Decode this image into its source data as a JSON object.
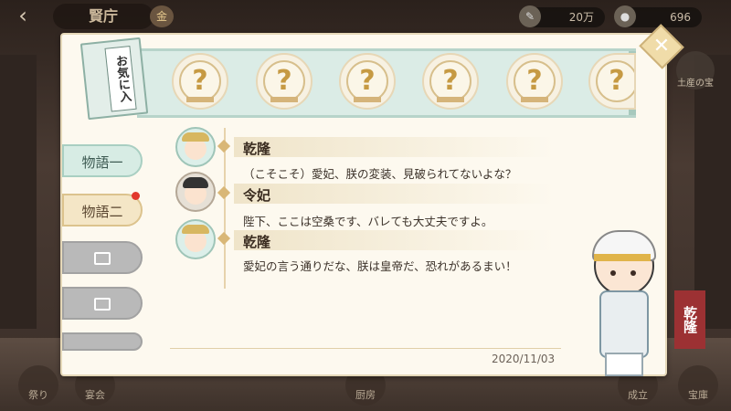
{
  "hud": {
    "back_icon": "back-arrow-icon",
    "title": "賢庁",
    "title_badge": "金",
    "resources": [
      {
        "icon": "quill-icon",
        "value": "20万"
      },
      {
        "icon": "coin-icon",
        "value": "696"
      }
    ],
    "right_button": "土産の宝",
    "bottom_buttons": [
      "祭り",
      "宴会",
      "厨房",
      "成立",
      "宝庫"
    ]
  },
  "favorites": {
    "book_label": "お気に入",
    "slots": [
      "?",
      "?",
      "?",
      "?",
      "?",
      "?"
    ]
  },
  "tabs": [
    {
      "label": "物語一",
      "state": "normal"
    },
    {
      "label": "物語二",
      "state": "active",
      "notification": true
    },
    {
      "label": "",
      "state": "locked"
    },
    {
      "label": "",
      "state": "locked"
    },
    {
      "label": "",
      "state": "locked"
    }
  ],
  "dialogue": [
    {
      "speaker": "乾隆",
      "text": "（こそこそ）愛妃、朕の変装、見破られてないよな？"
    },
    {
      "speaker": "令妃",
      "text": "陛下、ここは空桑です、バレても大丈夫ですよ。"
    },
    {
      "speaker": "乾隆",
      "text": "愛妃の言う通りだな、朕は皇帝だ、恐れがあるまい！"
    }
  ],
  "date": "2020/11/03",
  "character": {
    "name": "乾隆"
  },
  "colors": {
    "accent_gold": "#d9b777",
    "tab_green": "#d7ece4",
    "name_tag_red": "#9c3133"
  }
}
